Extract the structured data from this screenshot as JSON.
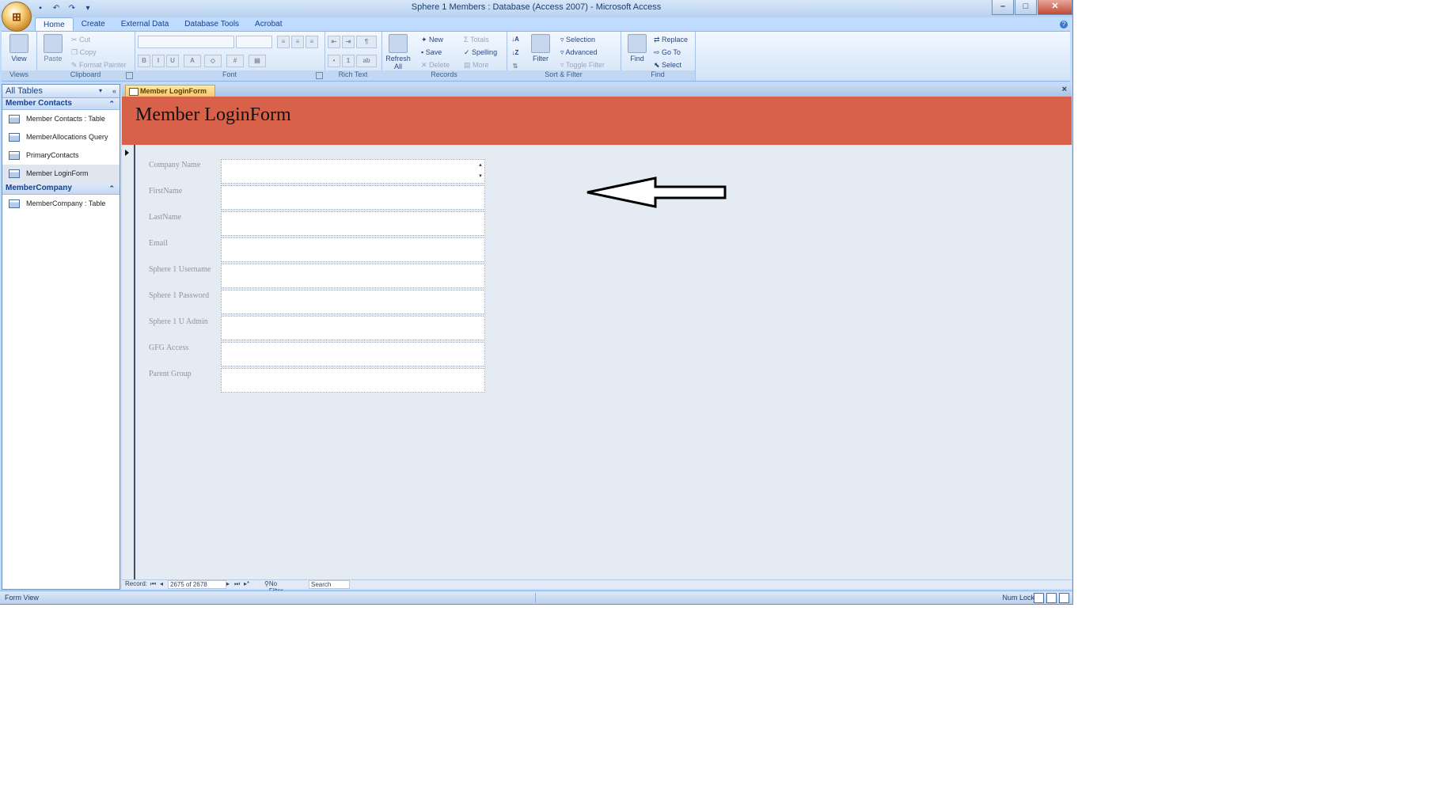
{
  "window": {
    "title": "Sphere 1 Members : Database (Access 2007) - Microsoft Access",
    "controls": [
      "–",
      "□",
      "✕"
    ]
  },
  "ribbon_tabs": [
    {
      "label": "Home",
      "active": true
    },
    {
      "label": "Create"
    },
    {
      "label": "External Data"
    },
    {
      "label": "Database Tools"
    },
    {
      "label": "Acrobat"
    }
  ],
  "ribbon": {
    "views": {
      "label": "Views",
      "view": "View"
    },
    "clipboard": {
      "label": "Clipboard",
      "paste": "Paste",
      "cut": "Cut",
      "copy": "Copy",
      "format_painter": "Format Painter"
    },
    "font": {
      "label": "Font"
    },
    "rich_text": {
      "label": "Rich Text"
    },
    "records": {
      "label": "Records",
      "refresh": "Refresh All",
      "new": "New",
      "save": "Save",
      "delete": "Delete",
      "totals": "Totals",
      "spelling": "Spelling",
      "more": "More"
    },
    "sort_filter": {
      "label": "Sort & Filter",
      "filter": "Filter",
      "selection": "Selection",
      "advanced": "Advanced",
      "toggle": "Toggle Filter"
    },
    "find": {
      "label": "Find",
      "find": "Find",
      "replace": "Replace",
      "goto": "Go To",
      "select": "Select"
    }
  },
  "nav_pane": {
    "header": "All Tables",
    "groups": [
      {
        "name": "Member Contacts",
        "items": [
          {
            "label": "Member Contacts : Table"
          },
          {
            "label": "MemberAllocations Query"
          },
          {
            "label": "PrimaryContacts"
          },
          {
            "label": "Member LoginForm",
            "selected": true
          }
        ]
      },
      {
        "name": "MemberCompany",
        "items": [
          {
            "label": "MemberCompany : Table"
          }
        ]
      }
    ]
  },
  "document": {
    "tab": "Member LoginForm",
    "form_title": "Member LoginForm",
    "header_color": "#d8614a",
    "fields": [
      {
        "label": "Company Name",
        "value": ""
      },
      {
        "label": "FirstName",
        "value": ""
      },
      {
        "label": "LastName",
        "value": ""
      },
      {
        "label": "Email",
        "value": ""
      },
      {
        "label": "Sphere 1 Username",
        "value": ""
      },
      {
        "label": "Sphere 1 Password",
        "value": ""
      },
      {
        "label": "Sphere 1 U Admin",
        "value": ""
      },
      {
        "label": "GFG Access",
        "value": ""
      },
      {
        "label": "Parent Group",
        "value": ""
      }
    ]
  },
  "record_nav": {
    "label": "Record:",
    "position": "2675 of 2678",
    "filter": "No Filter",
    "search": "Search"
  },
  "status_bar": {
    "left": "Form View",
    "right": "Num Lock"
  }
}
